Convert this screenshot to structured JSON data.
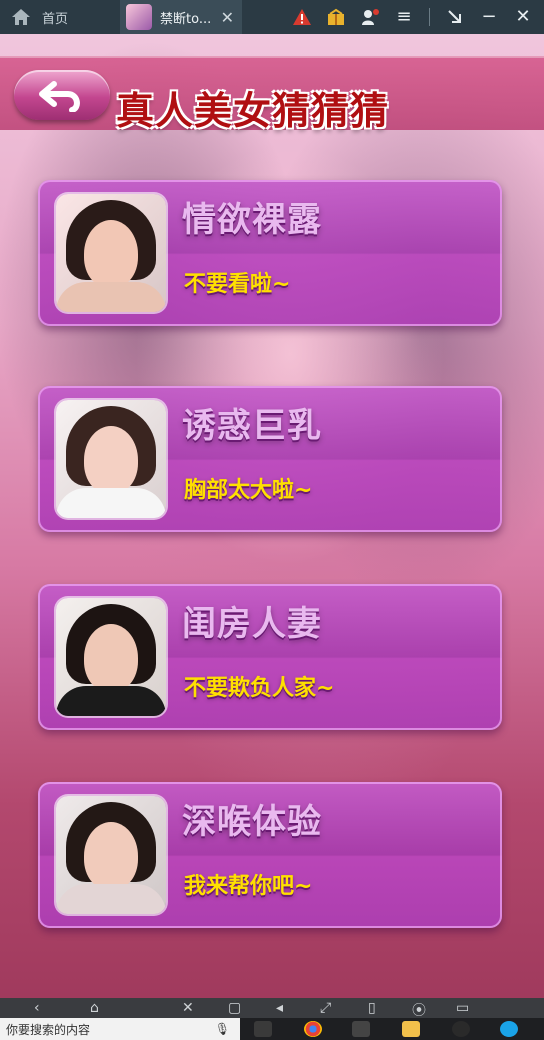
{
  "topbar": {
    "home_tab_label": "首页",
    "active_tab_label": "禁断to...",
    "icons": [
      "home-icon",
      "warning-icon",
      "gift-icon",
      "user-settings-icon",
      "menu-icon",
      "minimize-to-tray-icon",
      "minimize-icon",
      "close-icon"
    ]
  },
  "header": {
    "title": "真人美女猜猜猜",
    "back_icon": "back-arrow-icon"
  },
  "cards": [
    {
      "name": "情欲裸露",
      "sub": "不要看啦~"
    },
    {
      "name": "诱惑巨乳",
      "sub": "胸部太大啦~"
    },
    {
      "name": "闺房人妻",
      "sub": "不要欺负人家~"
    },
    {
      "name": "深喉体验",
      "sub": "我来帮你吧~"
    }
  ],
  "colors": {
    "title_red": "#b00f12",
    "card_purple": "#a93fb3",
    "sub_yellow": "#ffe000",
    "name_lilac": "#e9b9ef"
  },
  "taskbar": {
    "search_text": "你要搜索的内容"
  }
}
